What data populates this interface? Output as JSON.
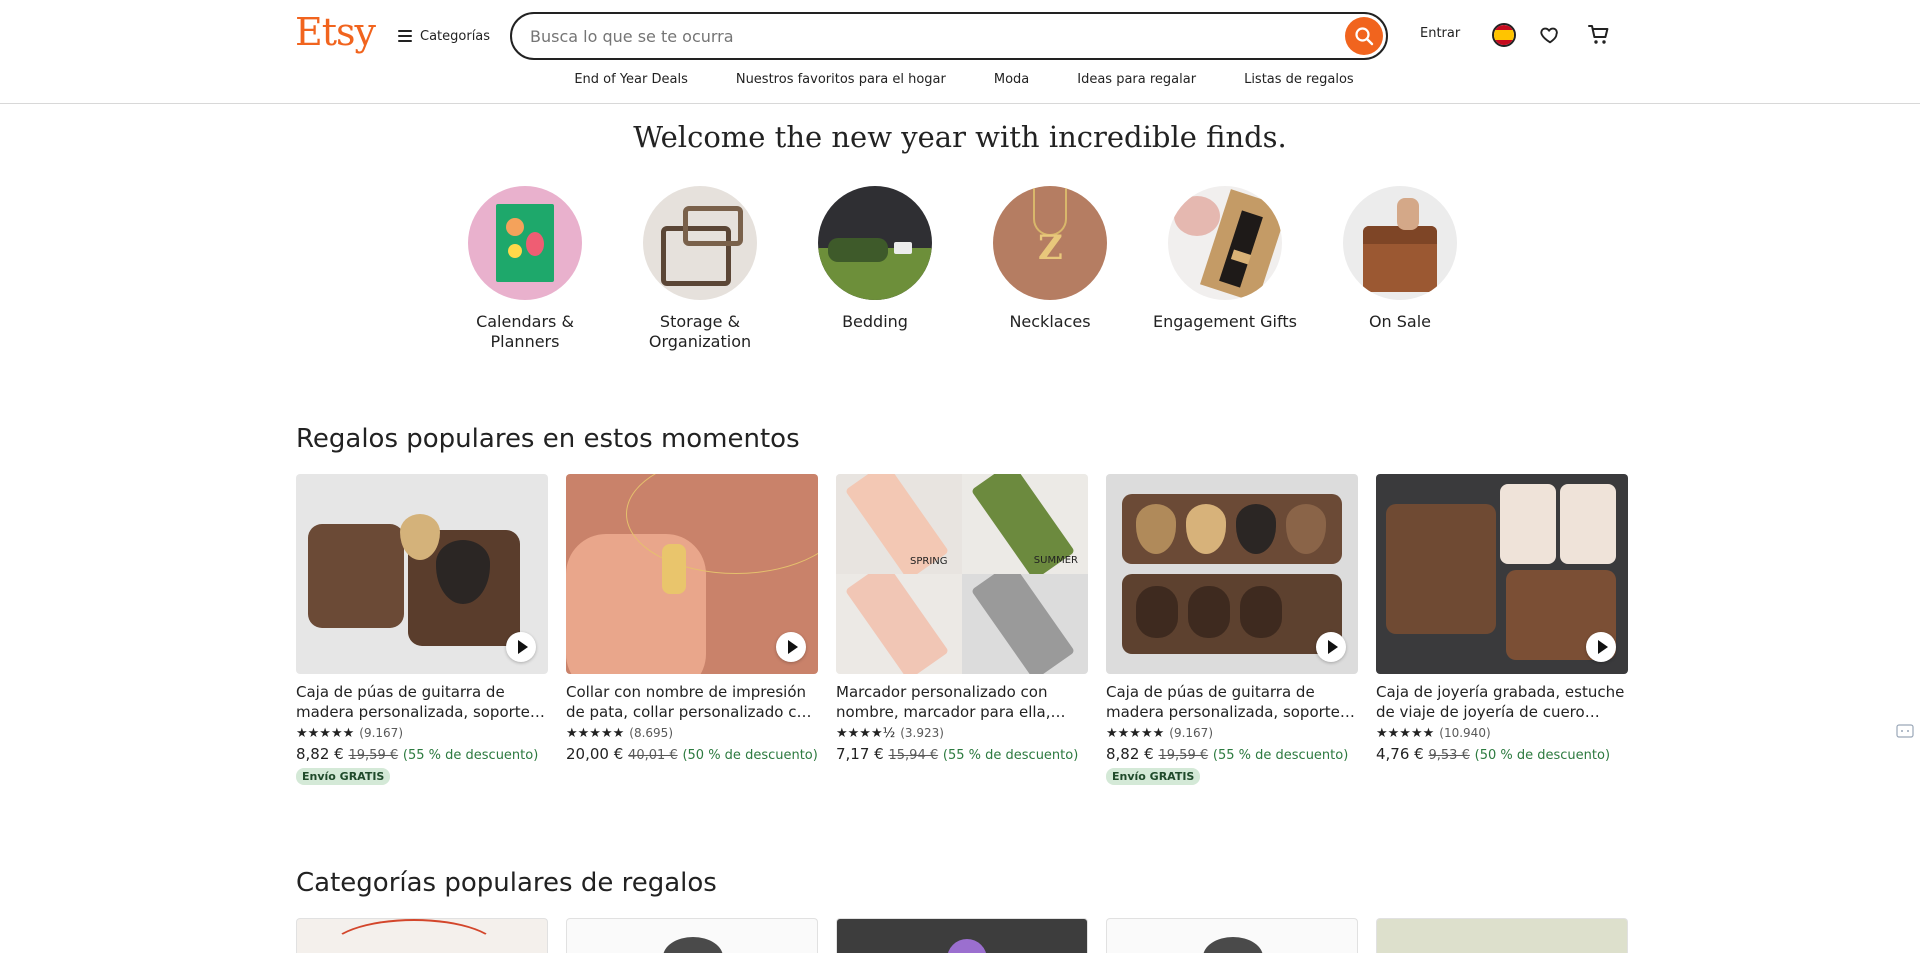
{
  "header": {
    "logo": "Etsy",
    "categories_label": "Categorías",
    "search_placeholder": "Busca lo que se te ocurra",
    "signin_label": "Entrar"
  },
  "subnav": [
    "End of Year Deals",
    "Nuestros favoritos para el hogar",
    "Moda",
    "Ideas para regalar",
    "Listas de regalos"
  ],
  "hero": {
    "title": "Welcome the new year with incredible finds.",
    "categories": [
      {
        "label": "Calendars & Planners"
      },
      {
        "label": "Storage & Organization"
      },
      {
        "label": "Bedding"
      },
      {
        "label": "Necklaces"
      },
      {
        "label": "Engagement Gifts"
      },
      {
        "label": "On Sale"
      }
    ]
  },
  "popular_gifts": {
    "title": "Regalos populares en estos momentos",
    "products": [
      {
        "title": "Caja de púas de guitarra de madera personalizada, soporte para púas de guitarra",
        "stars": "★★★★★",
        "reviews": "(9.167)",
        "price": "8,82 €",
        "old_price": "19,59 €",
        "discount": "(55 % de descuento)",
        "badge": "Envío GRATIS"
      },
      {
        "title": "Collar con nombre de impresión de pata, collar personalizado con huella",
        "stars": "★★★★★",
        "reviews": "(8.695)",
        "price": "20,00 €",
        "old_price": "40,01 €",
        "discount": "(50 % de descuento)",
        "badge": ""
      },
      {
        "title": "Marcador personalizado con nombre, marcador para ella, regalo",
        "stars": "★★★★½",
        "reviews": "(3.923)",
        "price": "7,17 €",
        "old_price": "15,94 €",
        "discount": "(55 % de descuento)",
        "badge": "",
        "labels": [
          "SPRING",
          "SUMMER"
        ]
      },
      {
        "title": "Caja de púas de guitarra de madera personalizada, soporte para púas de guitarra",
        "stars": "★★★★★",
        "reviews": "(9.167)",
        "price": "8,82 €",
        "old_price": "19,59 €",
        "discount": "(55 % de descuento)",
        "badge": "Envío GRATIS"
      },
      {
        "title": "Caja de joyería grabada, estuche de viaje de joyería de cuero personalizado",
        "stars": "★★★★★",
        "reviews": "(10.940)",
        "price": "4,76 €",
        "old_price": "9,53 €",
        "discount": "(50 % de descuento)",
        "badge": ""
      }
    ]
  },
  "popular_categories": {
    "title": "Categorías populares de regalos"
  },
  "colors": {
    "brand": "#F1641E",
    "discount_green": "#2c7a3f",
    "badge_bg": "#d4e9d7"
  }
}
